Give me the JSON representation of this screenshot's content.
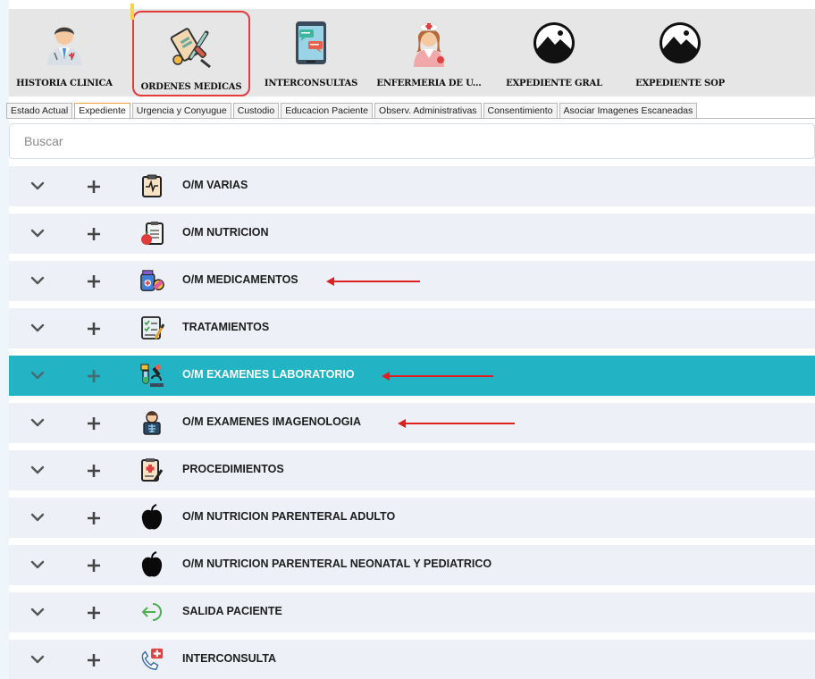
{
  "toolbar": {
    "items": [
      {
        "label": "HISTORIA CLINICA",
        "icon": "doctor-icon"
      },
      {
        "label": "ORDENES MEDICAS",
        "icon": "medical-tools-icon",
        "active": true
      },
      {
        "label": "INTERCONSULTAS",
        "icon": "tablet-chat-icon"
      },
      {
        "label": "ENFERMERIA DE U...",
        "icon": "nurse-icon"
      },
      {
        "label": "EXPEDIENTE GRAL",
        "icon": "mountain-image-icon"
      },
      {
        "label": "EXPEDIENTE SOP",
        "icon": "mountain-image-icon"
      }
    ],
    "active_border_color": "#e23b3b"
  },
  "tabs": [
    "Estado Actual",
    "Expediente",
    "Urgencia y Conyugue",
    "Custodio",
    "Educacion Paciente",
    "Observ. Administrativas",
    "Consentimiento",
    "Asociar Imagenes Escaneadas"
  ],
  "active_tab": "Expediente",
  "search": {
    "placeholder": "Buscar",
    "value": ""
  },
  "accordion": {
    "rows": [
      {
        "label": "O/M VARIAS",
        "icon": "clipboard-pulse-icon"
      },
      {
        "label": "O/M NUTRICION",
        "icon": "nutrition-clipboard-icon"
      },
      {
        "label": "O/M MEDICAMENTOS",
        "icon": "medicine-pills-icon",
        "annotated": true
      },
      {
        "label": "TRATAMIENTOS",
        "icon": "treatment-chart-icon"
      },
      {
        "label": "O/M EXAMENES LABORATORIO",
        "icon": "microscope-icon",
        "active": true,
        "annotated": true
      },
      {
        "label": "O/M EXAMENES IMAGENOLOGIA",
        "icon": "xray-doctor-icon",
        "annotated": true
      },
      {
        "label": "PROCEDIMIENTOS",
        "icon": "procedure-clipboard-icon"
      },
      {
        "label": "O/M NUTRICION PARENTERAL ADULTO",
        "icon": "apple-icon"
      },
      {
        "label": "O/M NUTRICION PARENTERAL NEONATAL Y PEDIATRICO",
        "icon": "apple-icon"
      },
      {
        "label": "SALIDA PACIENTE",
        "icon": "exit-arrow-icon"
      },
      {
        "label": "INTERCONSULTA",
        "icon": "phone-medical-icon"
      }
    ],
    "row_color": "#edf1f7",
    "active_color": "#22b3c4",
    "annotation_color": "#e02020"
  }
}
